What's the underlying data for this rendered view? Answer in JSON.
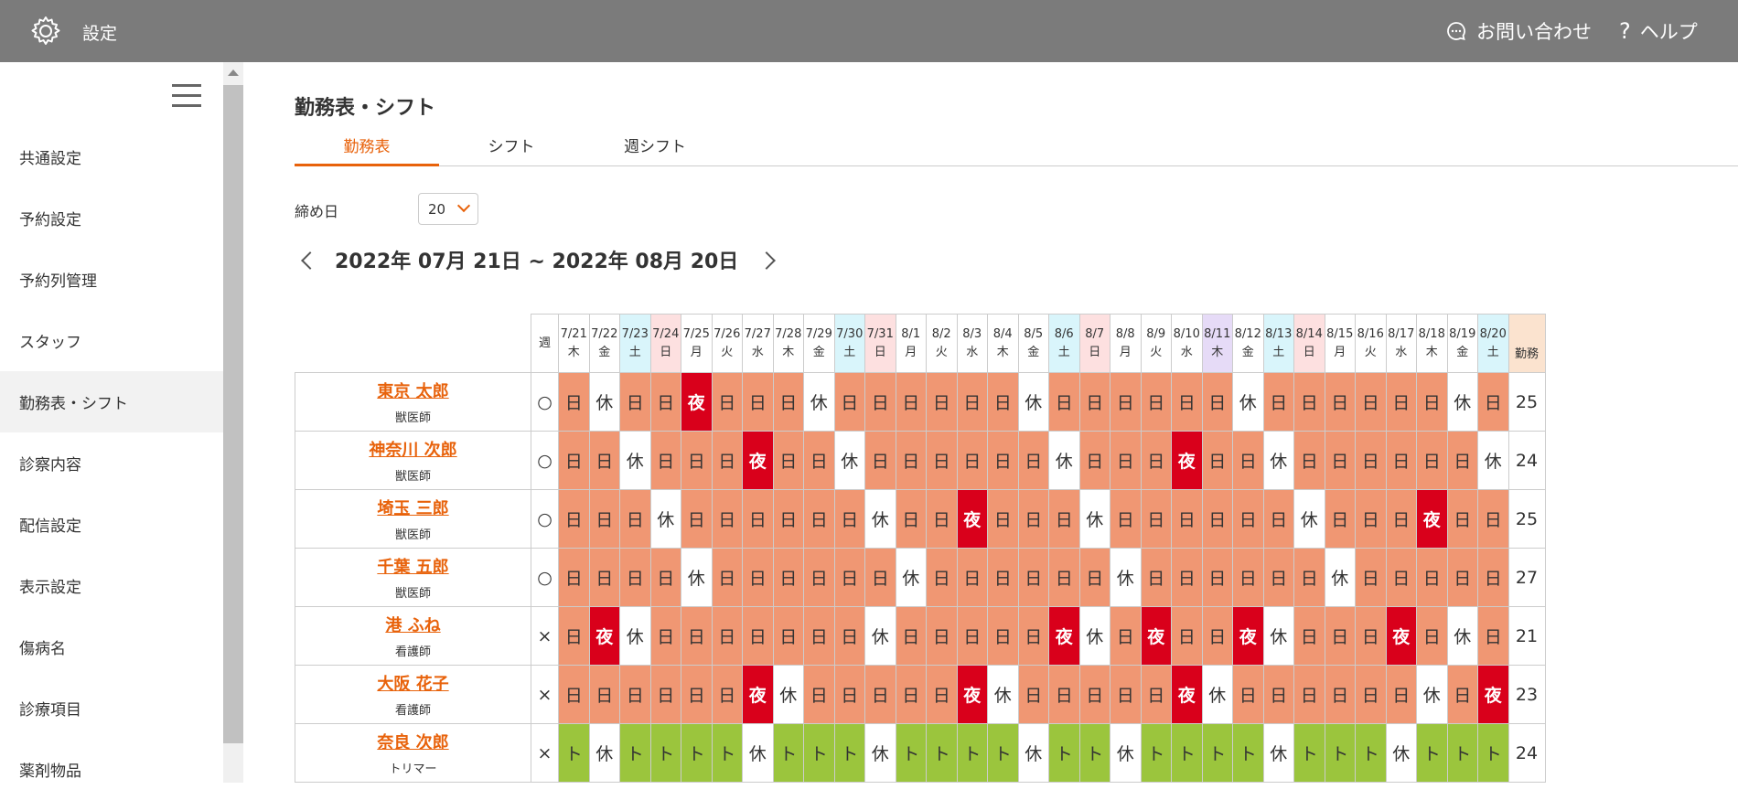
{
  "header": {
    "title": "設定",
    "contact_label": "お問い合わせ",
    "help_label": "ヘルプ"
  },
  "sidebar": {
    "items": [
      {
        "label": "共通設定"
      },
      {
        "label": "予約設定"
      },
      {
        "label": "予約列管理"
      },
      {
        "label": "スタッフ"
      },
      {
        "label": "勤務表・シフト",
        "active": true
      },
      {
        "label": "診察内容"
      },
      {
        "label": "配信設定"
      },
      {
        "label": "表示設定"
      },
      {
        "label": "傷病名"
      },
      {
        "label": "診療項目"
      },
      {
        "label": "薬剤物品"
      }
    ]
  },
  "main": {
    "page_title": "勤務表・シフト",
    "tabs": [
      {
        "label": "勤務表",
        "active": true
      },
      {
        "label": "シフト"
      },
      {
        "label": "週シフト"
      }
    ],
    "closing_day_label": "締め日",
    "closing_day_value": "20",
    "period": "2022年 07月 21日 ~ 2022年 08月 20日"
  },
  "roster": {
    "week_header": "週",
    "total_header": "勤務",
    "dates": [
      {
        "d": "7/21",
        "w": "木",
        "t": ""
      },
      {
        "d": "7/22",
        "w": "金",
        "t": ""
      },
      {
        "d": "7/23",
        "w": "土",
        "t": "sat"
      },
      {
        "d": "7/24",
        "w": "日",
        "t": "sun"
      },
      {
        "d": "7/25",
        "w": "月",
        "t": ""
      },
      {
        "d": "7/26",
        "w": "火",
        "t": ""
      },
      {
        "d": "7/27",
        "w": "水",
        "t": ""
      },
      {
        "d": "7/28",
        "w": "木",
        "t": ""
      },
      {
        "d": "7/29",
        "w": "金",
        "t": ""
      },
      {
        "d": "7/30",
        "w": "土",
        "t": "sat"
      },
      {
        "d": "7/31",
        "w": "日",
        "t": "sun"
      },
      {
        "d": "8/1",
        "w": "月",
        "t": ""
      },
      {
        "d": "8/2",
        "w": "火",
        "t": ""
      },
      {
        "d": "8/3",
        "w": "水",
        "t": ""
      },
      {
        "d": "8/4",
        "w": "木",
        "t": ""
      },
      {
        "d": "8/5",
        "w": "金",
        "t": ""
      },
      {
        "d": "8/6",
        "w": "土",
        "t": "sat"
      },
      {
        "d": "8/7",
        "w": "日",
        "t": "sun"
      },
      {
        "d": "8/8",
        "w": "月",
        "t": ""
      },
      {
        "d": "8/9",
        "w": "火",
        "t": ""
      },
      {
        "d": "8/10",
        "w": "水",
        "t": ""
      },
      {
        "d": "8/11",
        "w": "木",
        "t": "hol"
      },
      {
        "d": "8/12",
        "w": "金",
        "t": ""
      },
      {
        "d": "8/13",
        "w": "土",
        "t": "sat"
      },
      {
        "d": "8/14",
        "w": "日",
        "t": "sun"
      },
      {
        "d": "8/15",
        "w": "月",
        "t": ""
      },
      {
        "d": "8/16",
        "w": "火",
        "t": ""
      },
      {
        "d": "8/17",
        "w": "水",
        "t": ""
      },
      {
        "d": "8/18",
        "w": "木",
        "t": ""
      },
      {
        "d": "8/19",
        "w": "金",
        "t": ""
      },
      {
        "d": "8/20",
        "w": "土",
        "t": "sat"
      }
    ],
    "staff": [
      {
        "name": "東京 太郎",
        "role": "獣医師",
        "week": "○",
        "total": "25",
        "shifts": [
          "日",
          "休",
          "日",
          "日",
          "夜",
          "日",
          "日",
          "日",
          "休",
          "日",
          "日",
          "日",
          "日",
          "日",
          "日",
          "休",
          "日",
          "日",
          "日",
          "日",
          "日",
          "日",
          "休",
          "日",
          "日",
          "日",
          "日",
          "日",
          "日",
          "休",
          "日"
        ]
      },
      {
        "name": "神奈川 次郎",
        "role": "獣医師",
        "week": "○",
        "total": "24",
        "shifts": [
          "日",
          "日",
          "休",
          "日",
          "日",
          "日",
          "夜",
          "日",
          "日",
          "休",
          "日",
          "日",
          "日",
          "日",
          "日",
          "日",
          "休",
          "日",
          "日",
          "日",
          "夜",
          "日",
          "日",
          "休",
          "日",
          "日",
          "日",
          "日",
          "日",
          "日",
          "休"
        ]
      },
      {
        "name": "埼玉 三郎",
        "role": "獣医師",
        "week": "○",
        "total": "25",
        "shifts": [
          "日",
          "日",
          "日",
          "休",
          "日",
          "日",
          "日",
          "日",
          "日",
          "日",
          "休",
          "日",
          "日",
          "夜",
          "日",
          "日",
          "日",
          "休",
          "日",
          "日",
          "日",
          "日",
          "日",
          "日",
          "休",
          "日",
          "日",
          "日",
          "夜",
          "日",
          "日"
        ]
      },
      {
        "name": "千葉 五郎",
        "role": "獣医師",
        "week": "○",
        "total": "27",
        "shifts": [
          "日",
          "日",
          "日",
          "日",
          "休",
          "日",
          "日",
          "日",
          "日",
          "日",
          "日",
          "休",
          "日",
          "日",
          "日",
          "日",
          "日",
          "日",
          "休",
          "日",
          "日",
          "日",
          "日",
          "日",
          "日",
          "休",
          "日",
          "日",
          "日",
          "日",
          "日"
        ]
      },
      {
        "name": "港 ふね",
        "role": "看護師",
        "week": "×",
        "total": "21",
        "shifts": [
          "日",
          "夜",
          "休",
          "日",
          "日",
          "日",
          "日",
          "日",
          "日",
          "日",
          "休",
          "日",
          "日",
          "日",
          "日",
          "日",
          "夜",
          "休",
          "日",
          "夜",
          "日",
          "日",
          "夜",
          "休",
          "日",
          "日",
          "日",
          "夜",
          "日",
          "休",
          "日"
        ]
      },
      {
        "name": "大阪 花子",
        "role": "看護師",
        "week": "×",
        "total": "23",
        "shifts": [
          "日",
          "日",
          "日",
          "日",
          "日",
          "日",
          "夜",
          "休",
          "日",
          "日",
          "日",
          "日",
          "日",
          "夜",
          "休",
          "日",
          "日",
          "日",
          "日",
          "日",
          "夜",
          "休",
          "日",
          "日",
          "日",
          "日",
          "日",
          "日",
          "休",
          "日",
          "夜"
        ]
      },
      {
        "name": "奈良 次郎",
        "role": "トリマー",
        "week": "×",
        "total": "24",
        "shifts": [
          "ト",
          "休",
          "ト",
          "ト",
          "ト",
          "ト",
          "休",
          "ト",
          "ト",
          "ト",
          "休",
          "ト",
          "ト",
          "ト",
          "ト",
          "休",
          "ト",
          "ト",
          "休",
          "ト",
          "ト",
          "ト",
          "ト",
          "休",
          "ト",
          "ト",
          "ト",
          "休",
          "ト",
          "ト",
          "ト"
        ]
      }
    ]
  }
}
